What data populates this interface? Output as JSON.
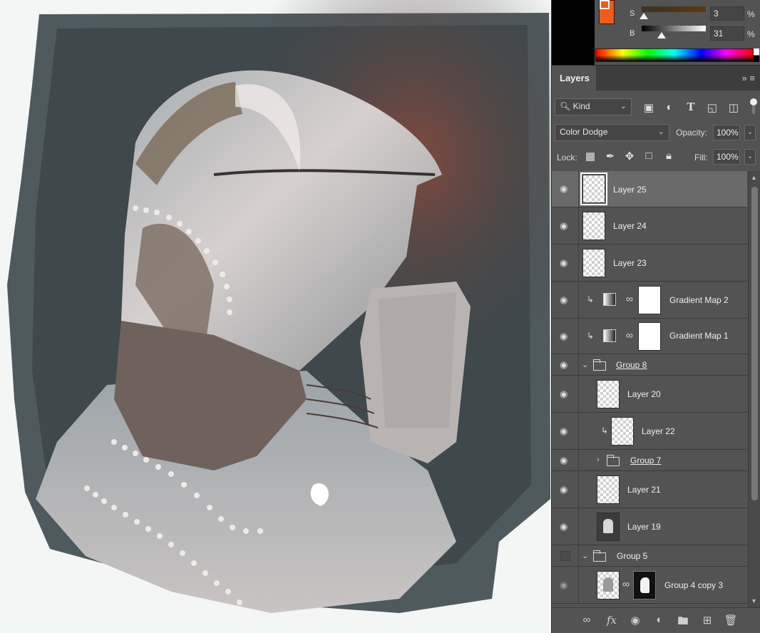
{
  "color_panel": {
    "s_label": "S",
    "s_value": "3",
    "b_label": "B",
    "b_value": "31",
    "percent": "%",
    "foreground_color": "#ffffff",
    "background_color": "#f05a1a",
    "saturation_level": 0.03,
    "brightness_level": 0.31
  },
  "layers_panel": {
    "tab_label": "Layers",
    "panel_menu": "»  ≡",
    "filter": {
      "kind_label": "Kind",
      "search_icon": "search-icon",
      "filter_icons": [
        "image-filter-icon",
        "adjustment-filter-icon",
        "type-filter-icon",
        "shape-filter-icon",
        "smart-object-filter-icon"
      ]
    },
    "blend_mode": "Color Dodge",
    "opacity_label": "Opacity:",
    "opacity_value": "100%",
    "lock_label": "Lock:",
    "fill_label": "Fill:",
    "fill_value": "100%",
    "lock_icons": [
      "lock-transparent-icon",
      "lock-paint-icon",
      "lock-position-icon",
      "lock-artboard-icon",
      "lock-all-icon"
    ],
    "layers": [
      {
        "name": "Layer 25",
        "type": "pixel",
        "visible": true,
        "selected": true
      },
      {
        "name": "Layer 24",
        "type": "pixel",
        "visible": true
      },
      {
        "name": "Layer 23",
        "type": "pixel",
        "visible": true
      },
      {
        "name": "Gradient Map 2",
        "type": "adjustment",
        "visible": true,
        "clipped": true
      },
      {
        "name": "Gradient Map 1",
        "type": "adjustment",
        "visible": true,
        "clipped": true
      },
      {
        "name": "Group 8",
        "type": "group",
        "visible": true,
        "expanded": true
      },
      {
        "name": "Layer 20",
        "type": "pixel",
        "visible": true
      },
      {
        "name": "Layer 22",
        "type": "pixel",
        "visible": true,
        "clipped": true
      },
      {
        "name": "Group 7",
        "type": "group",
        "visible": true,
        "expanded": false
      },
      {
        "name": "Layer 21",
        "type": "pixel",
        "visible": true
      },
      {
        "name": "Layer 19",
        "type": "pixel",
        "visible": true
      },
      {
        "name": "Group 5",
        "type": "group",
        "visible": false,
        "expanded": true
      },
      {
        "name": "Group 4 copy 3",
        "type": "pixel-masked",
        "visible": true
      }
    ],
    "footer_icons": [
      "link-layers-icon",
      "fx-icon",
      "add-mask-icon",
      "new-adjustment-icon",
      "new-group-icon",
      "new-layer-icon",
      "delete-layer-icon"
    ],
    "fx_label": "fx"
  }
}
